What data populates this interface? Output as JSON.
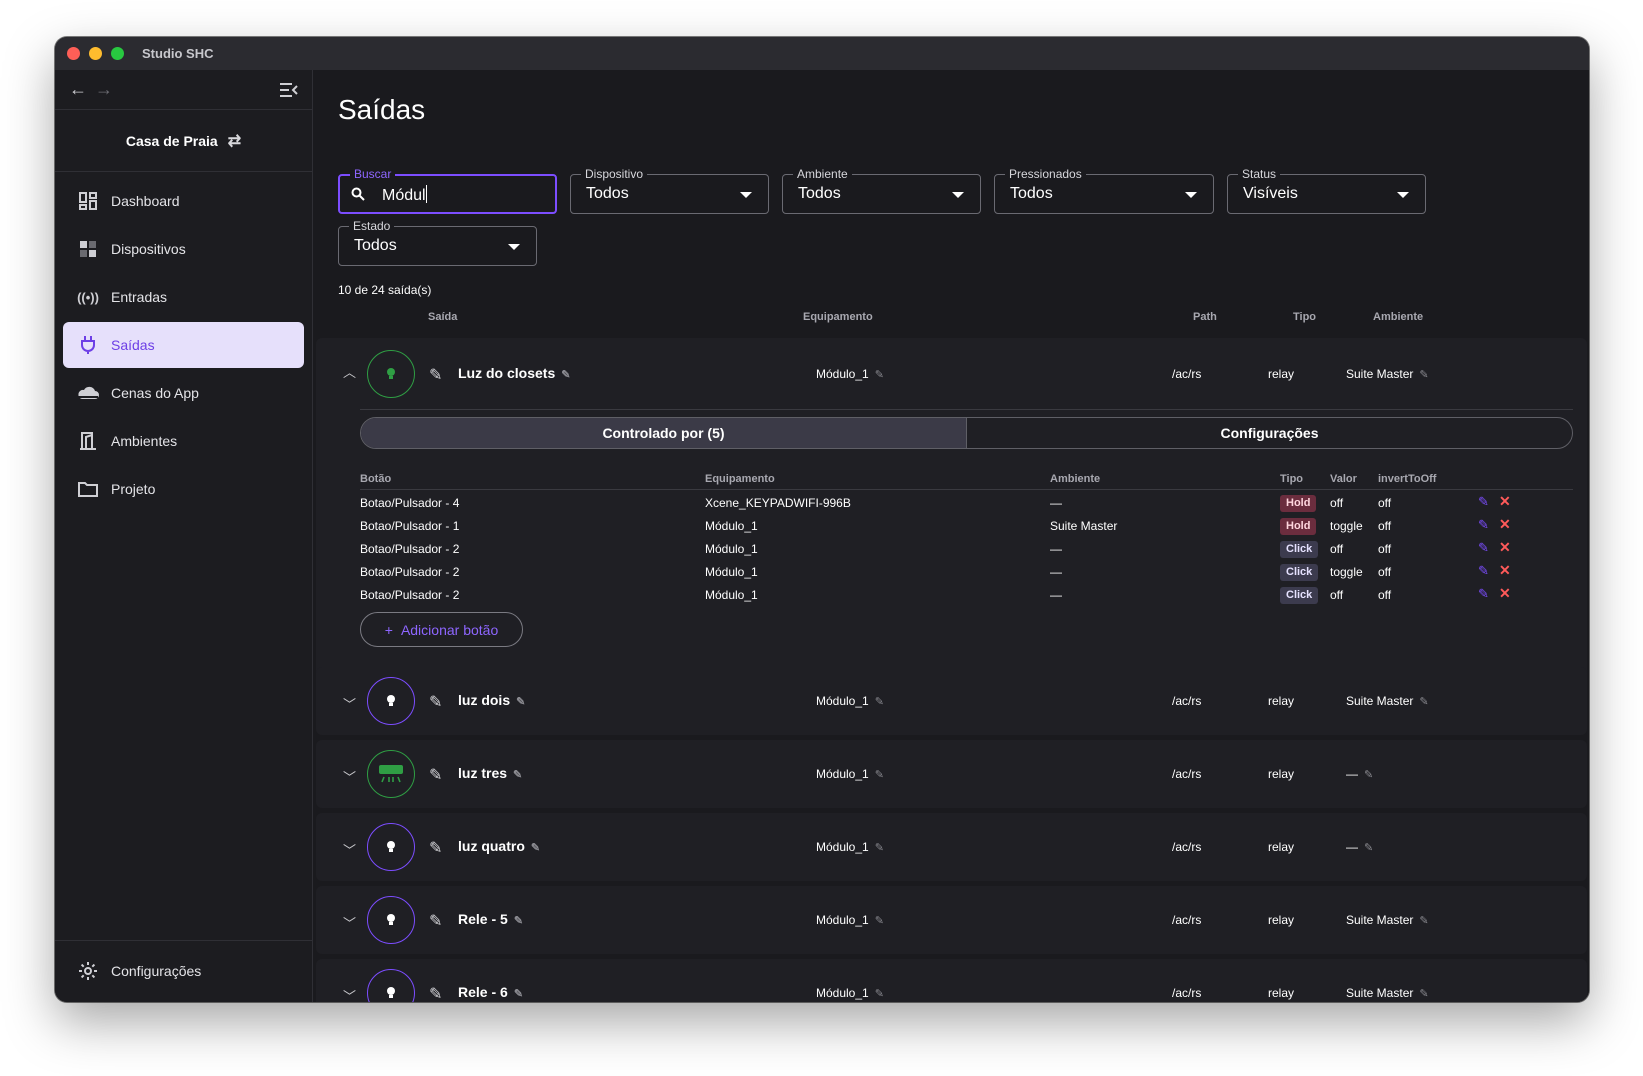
{
  "window": {
    "title": "Studio SHC"
  },
  "sidebar": {
    "house": "Casa de Praia",
    "items": [
      {
        "label": "Dashboard",
        "icon": "dashboard-icon"
      },
      {
        "label": "Dispositivos",
        "icon": "devices-icon"
      },
      {
        "label": "Entradas",
        "icon": "broadcast-icon"
      },
      {
        "label": "Saídas",
        "icon": "plug-icon",
        "active": true
      },
      {
        "label": "Cenas do App",
        "icon": "cloud-icon"
      },
      {
        "label": "Ambientes",
        "icon": "door-icon"
      },
      {
        "label": "Projeto",
        "icon": "folder-icon"
      }
    ],
    "settings": "Configurações"
  },
  "page": {
    "title": "Saídas",
    "filters": {
      "search": {
        "label": "Buscar",
        "value": "Módul"
      },
      "dispositivo": {
        "label": "Dispositivo",
        "value": "Todos"
      },
      "ambiente": {
        "label": "Ambiente",
        "value": "Todos"
      },
      "pressionados": {
        "label": "Pressionados",
        "value": "Todos"
      },
      "status": {
        "label": "Status",
        "value": "Visíveis"
      },
      "estado": {
        "label": "Estado",
        "value": "Todos"
      }
    },
    "count": "10 de 24 saída(s)",
    "columns": {
      "saida": "Saída",
      "equipamento": "Equipamento",
      "path": "Path",
      "tipo": "Tipo",
      "ambiente": "Ambiente"
    },
    "outputs": [
      {
        "name": "Luz do closets",
        "equip": "Módulo_1",
        "path": "/ac/rs",
        "tipo": "relay",
        "ambiente": "Suite Master",
        "expanded": true,
        "icon": "bulb",
        "on": true
      },
      {
        "name": "luz dois",
        "equip": "Módulo_1",
        "path": "/ac/rs",
        "tipo": "relay",
        "ambiente": "Suite Master",
        "icon": "bulb"
      },
      {
        "name": "luz tres",
        "equip": "Módulo_1",
        "path": "/ac/rs",
        "tipo": "relay",
        "ambiente": "—",
        "icon": "ac",
        "on": true
      },
      {
        "name": "luz quatro",
        "equip": "Módulo_1",
        "path": "/ac/rs",
        "tipo": "relay",
        "ambiente": "—",
        "icon": "bulb"
      },
      {
        "name": "Rele - 5",
        "equip": "Módulo_1",
        "path": "/ac/rs",
        "tipo": "relay",
        "ambiente": "Suite Master",
        "icon": "bulb"
      },
      {
        "name": "Rele - 6",
        "equip": "Módulo_1",
        "path": "/ac/rs",
        "tipo": "relay",
        "ambiente": "Suite Master",
        "icon": "bulb"
      }
    ],
    "detail": {
      "tabs": [
        "Controlado por (5)",
        "Configurações"
      ],
      "columns": {
        "botao": "Botão",
        "equipamento": "Equipamento",
        "ambiente": "Ambiente",
        "tipo": "Tipo",
        "valor": "Valor",
        "invert": "invertToOff"
      },
      "rows": [
        {
          "botao": "Botao/Pulsador - 4",
          "equip": "Xcene_KEYPADWIFI-996B",
          "ambiente": "—",
          "tipo": "Hold",
          "valor": "off",
          "invert": "off"
        },
        {
          "botao": "Botao/Pulsador - 1",
          "equip": "Módulo_1",
          "ambiente": "Suite Master",
          "tipo": "Hold",
          "valor": "toggle",
          "invert": "off"
        },
        {
          "botao": "Botao/Pulsador - 2",
          "equip": "Módulo_1",
          "ambiente": "—",
          "tipo": "Click",
          "valor": "off",
          "invert": "off"
        },
        {
          "botao": "Botao/Pulsador - 2",
          "equip": "Módulo_1",
          "ambiente": "—",
          "tipo": "Click",
          "valor": "toggle",
          "invert": "off"
        },
        {
          "botao": "Botao/Pulsador - 2",
          "equip": "Módulo_1",
          "ambiente": "—",
          "tipo": "Click",
          "valor": "off",
          "invert": "off"
        }
      ],
      "add_label": "Adicionar botão"
    }
  },
  "colors": {
    "accent": "#7c4dff",
    "green": "#2f9e44",
    "hold": "#6b2d3e",
    "click": "#3c3b4e",
    "danger": "#ff5a5a"
  }
}
